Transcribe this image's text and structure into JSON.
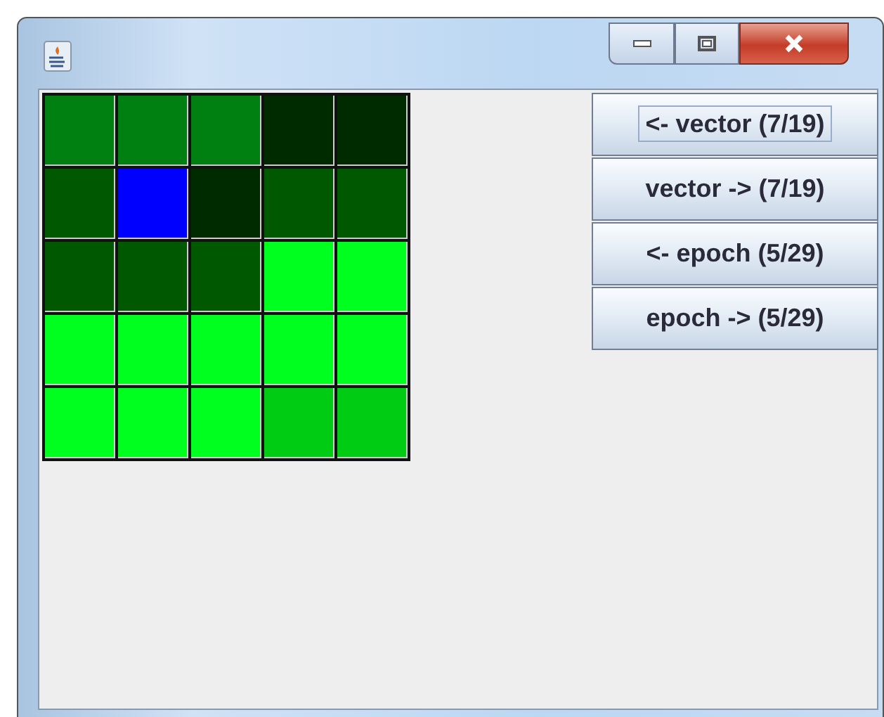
{
  "grid": [
    [
      {
        "color": "#008010"
      },
      {
        "color": "#008010"
      },
      {
        "color": "#008010"
      },
      {
        "color": "#002b00"
      },
      {
        "color": "#002b00"
      }
    ],
    [
      {
        "color": "#005800"
      },
      {
        "color": "#0000ff"
      },
      {
        "color": "#002b00"
      },
      {
        "color": "#005800"
      },
      {
        "color": "#005800"
      }
    ],
    [
      {
        "color": "#005800"
      },
      {
        "color": "#005800"
      },
      {
        "color": "#005800"
      },
      {
        "color": "#00ff1f"
      },
      {
        "color": "#00ff1f"
      }
    ],
    [
      {
        "color": "#00ff1f"
      },
      {
        "color": "#00ff1f"
      },
      {
        "color": "#00ff1f"
      },
      {
        "color": "#00ff1f"
      },
      {
        "color": "#00ff1f"
      }
    ],
    [
      {
        "color": "#00ff1f"
      },
      {
        "color": "#00ff1f"
      },
      {
        "color": "#00ff1f"
      },
      {
        "color": "#00cc14"
      },
      {
        "color": "#00cc14"
      }
    ]
  ],
  "buttons": [
    {
      "label": "<- vector (7/19)",
      "focused": true
    },
    {
      "label": "vector -> (7/19)",
      "focused": false
    },
    {
      "label": "<- epoch (5/29)",
      "focused": false
    },
    {
      "label": "epoch -> (5/29)",
      "focused": false
    }
  ]
}
